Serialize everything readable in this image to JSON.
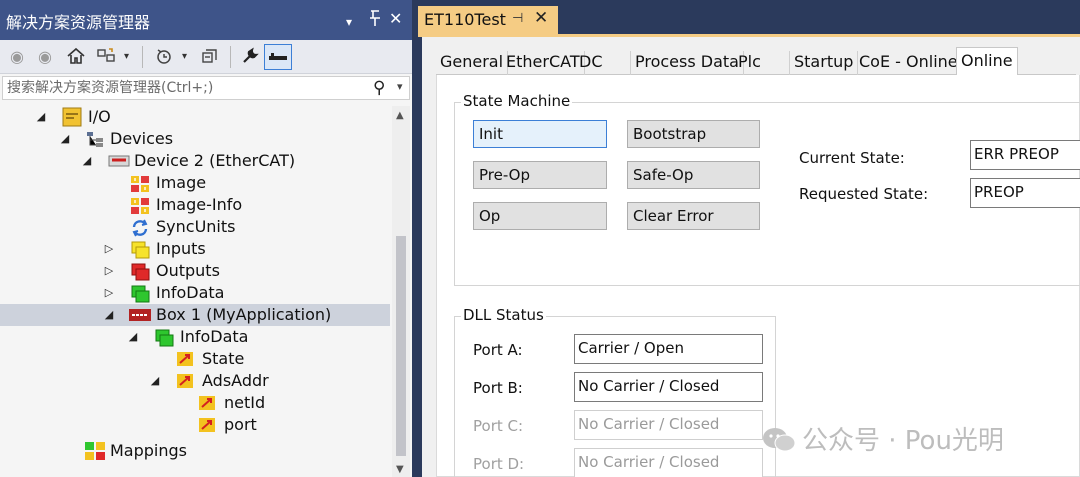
{
  "solution_explorer": {
    "title": "解决方案资源管理器",
    "title_controls": [
      "▾",
      "⊓",
      "✕"
    ],
    "search_placeholder": "搜索解决方案资源管理器(Ctrl+;)",
    "tree": [
      {
        "label": "I/O",
        "expander": "◢",
        "icon": "io-folder-icon"
      },
      {
        "label": "Devices",
        "expander": "◢",
        "icon": "devices-icon"
      },
      {
        "label": "Device 2 (EtherCAT)",
        "expander": "◢",
        "icon": "ethercat-device-icon"
      },
      {
        "label": "Image",
        "expander": "",
        "icon": "image-icon"
      },
      {
        "label": "Image-Info",
        "expander": "",
        "icon": "image-info-icon"
      },
      {
        "label": "SyncUnits",
        "expander": "",
        "icon": "syncunits-icon"
      },
      {
        "label": "Inputs",
        "expander": "▷",
        "icon": "inputs-icon"
      },
      {
        "label": "Outputs",
        "expander": "▷",
        "icon": "outputs-icon"
      },
      {
        "label": "InfoData",
        "expander": "▷",
        "icon": "infodata-icon"
      },
      {
        "label": "Box 1 (MyApplication)",
        "expander": "◢",
        "icon": "box-icon"
      },
      {
        "label": "InfoData",
        "expander": "◢",
        "icon": "infodata-icon"
      },
      {
        "label": "State",
        "expander": "",
        "icon": "variable-icon"
      },
      {
        "label": "AdsAddr",
        "expander": "◢",
        "icon": "variable-icon"
      },
      {
        "label": "netId",
        "expander": "",
        "icon": "variable-icon"
      },
      {
        "label": "port",
        "expander": "",
        "icon": "variable-icon"
      },
      {
        "label": "Mappings",
        "expander": "",
        "icon": "mappings-icon"
      }
    ]
  },
  "document": {
    "tab_title": "ET110Test",
    "tab_pin": "⊣",
    "tab_close": "✕",
    "tabs": [
      "General",
      "EtherCAT",
      "DC",
      "Process Data",
      "Plc",
      "Startup",
      "CoE - Online",
      "Online"
    ],
    "active_tab": "Online",
    "state_machine": {
      "title": "State Machine",
      "buttons": [
        "Init",
        "Bootstrap",
        "Pre-Op",
        "Safe-Op",
        "Op",
        "Clear Error"
      ],
      "current_state_label": "Current State:",
      "current_state_value": "ERR PREOP",
      "requested_state_label": "Requested State:",
      "requested_state_value": "PREOP"
    },
    "dll_status": {
      "title": "DLL Status",
      "ports": [
        {
          "label": "Port A:",
          "value": "Carrier / Open"
        },
        {
          "label": "Port B:",
          "value": "No Carrier / Closed"
        },
        {
          "label": "Port C:",
          "value": "No Carrier / Closed"
        },
        {
          "label": "Port D:",
          "value": "No Carrier / Closed"
        }
      ]
    }
  },
  "watermark": {
    "text": "公众号 · Pou光明"
  },
  "colors": {
    "frame_blue": "#2b3a5c",
    "title_blue": "#3e5489",
    "tab_yellow": "#f5cc84",
    "selected_row": "#cdd2dc"
  }
}
